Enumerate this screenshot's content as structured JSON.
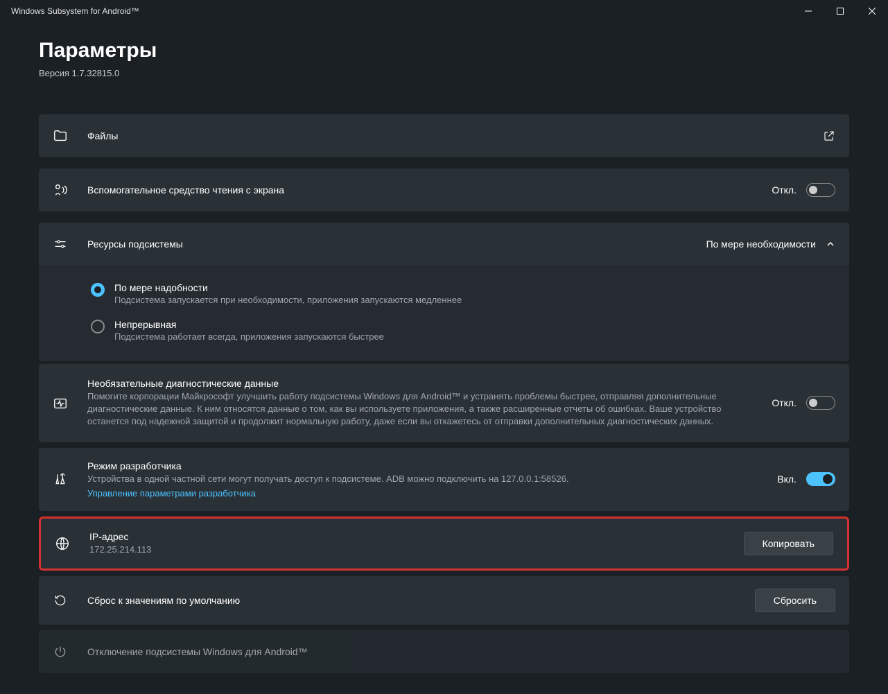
{
  "titlebar": {
    "title": "Windows Subsystem for Android™"
  },
  "header": {
    "title": "Параметры",
    "version": "Версия 1.7.32815.0"
  },
  "files": {
    "label": "Файлы"
  },
  "screenReader": {
    "label": "Вспомогательное средство чтения с экрана",
    "state": "Откл."
  },
  "resources": {
    "label": "Ресурсы подсистемы",
    "selected": "По мере необходимости",
    "options": [
      {
        "title": "По мере надобности",
        "sub": "Подсистема запускается при необходимости, приложения запускаются медленнее",
        "selected": true
      },
      {
        "title": "Непрерывная",
        "sub": "Подсистема работает всегда, приложения запускаются быстрее",
        "selected": false
      }
    ]
  },
  "diagnostics": {
    "title": "Необязательные диагностические данные",
    "sub": "Помогите корпорации Майкрософт улучшить работу подсистемы Windows для Android™ и устранять проблемы быстрее, отправляя дополнительные диагностические данные. К ним относятся данные о том, как вы используете приложения, а также расширенные отчеты об ошибках. Ваше устройство останется под надежной защитой и продолжит нормальную работу, даже если вы откажетесь от отправки дополнительных диагностических данных.",
    "state": "Откл."
  },
  "developer": {
    "title": "Режим разработчика",
    "sub": "Устройства в одной частной сети могут получать доступ к подсистеме. ADB можно подключить на 127.0.0.1:58526.",
    "link": "Управление параметрами разработчика",
    "state": "Вкл."
  },
  "ip": {
    "title": "IP-адрес",
    "value": "172.25.214.113",
    "button": "Копировать"
  },
  "reset": {
    "title": "Сброс к значениям по умолчанию",
    "button": "Сбросить"
  },
  "shutdown": {
    "title": "Отключение подсистемы Windows для Android™"
  }
}
